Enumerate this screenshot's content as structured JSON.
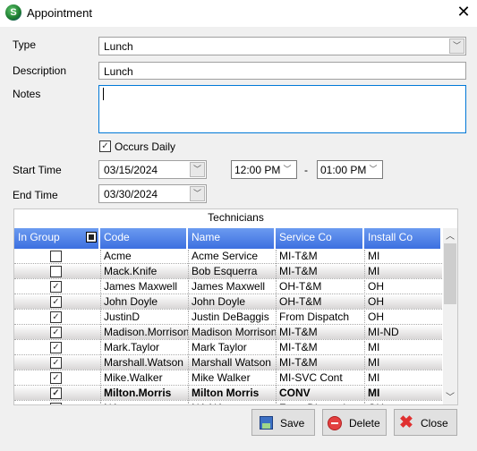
{
  "window": {
    "title": "Appointment",
    "icon": "app-s-logo"
  },
  "form": {
    "type_label": "Type",
    "type_value": "Lunch",
    "description_label": "Description",
    "description_value": "Lunch",
    "notes_label": "Notes",
    "notes_value": "",
    "occurs_daily_label": "Occurs Daily",
    "occurs_daily_checked": true,
    "start_time_label": "Start Time",
    "start_date": "03/15/2024",
    "time_from": "12:00 PM",
    "time_separator": "-",
    "time_to": "01:00 PM",
    "end_time_label": "End Time",
    "end_date": "03/30/2024"
  },
  "grid": {
    "title": "Technicians",
    "columns": [
      "In Group",
      "Code",
      "Name",
      "Service Co",
      "Install Co"
    ],
    "rows": [
      {
        "in_group": false,
        "code": "Acme",
        "name": "Acme Service",
        "service_co": "MI-T&M",
        "install_co": "MI"
      },
      {
        "in_group": false,
        "code": "Mack.Knife",
        "name": "Bob  Esquerra",
        "service_co": "MI-T&M",
        "install_co": "MI"
      },
      {
        "in_group": true,
        "code": "James Maxwell",
        "name": "James Maxwell",
        "service_co": "OH-T&M",
        "install_co": "OH"
      },
      {
        "in_group": true,
        "code": "John Doyle",
        "name": "John Doyle",
        "service_co": "OH-T&M",
        "install_co": "OH"
      },
      {
        "in_group": true,
        "code": "JustinD",
        "name": "Justin DeBaggis",
        "service_co": "From Dispatch",
        "install_co": "OH"
      },
      {
        "in_group": true,
        "code": "Madison.Morrison",
        "name": "Madison Morrison",
        "service_co": "MI-T&M",
        "install_co": "MI-ND"
      },
      {
        "in_group": true,
        "code": "Mark.Taylor",
        "name": "Mark Taylor",
        "service_co": "MI-T&M",
        "install_co": "MI"
      },
      {
        "in_group": true,
        "code": "Marshall.Watson",
        "name": "Marshall Watson",
        "service_co": "MI-T&M",
        "install_co": "MI"
      },
      {
        "in_group": true,
        "code": "Mike.Walker",
        "name": "Mike Walker",
        "service_co": "MI-SVC Cont",
        "install_co": "MI"
      },
      {
        "in_group": true,
        "code": "Milton.Morris",
        "name": "Milton Morris",
        "service_co": "CONV",
        "install_co": "MI",
        "selected": true
      },
      {
        "in_group": true,
        "code": "NA",
        "name": "NA NA",
        "service_co": "From Dispatch",
        "install_co": "OH"
      }
    ]
  },
  "buttons": {
    "save": "Save",
    "delete": "Delete",
    "close": "Close"
  },
  "colors": {
    "header_blue": "#3c6fe0"
  }
}
